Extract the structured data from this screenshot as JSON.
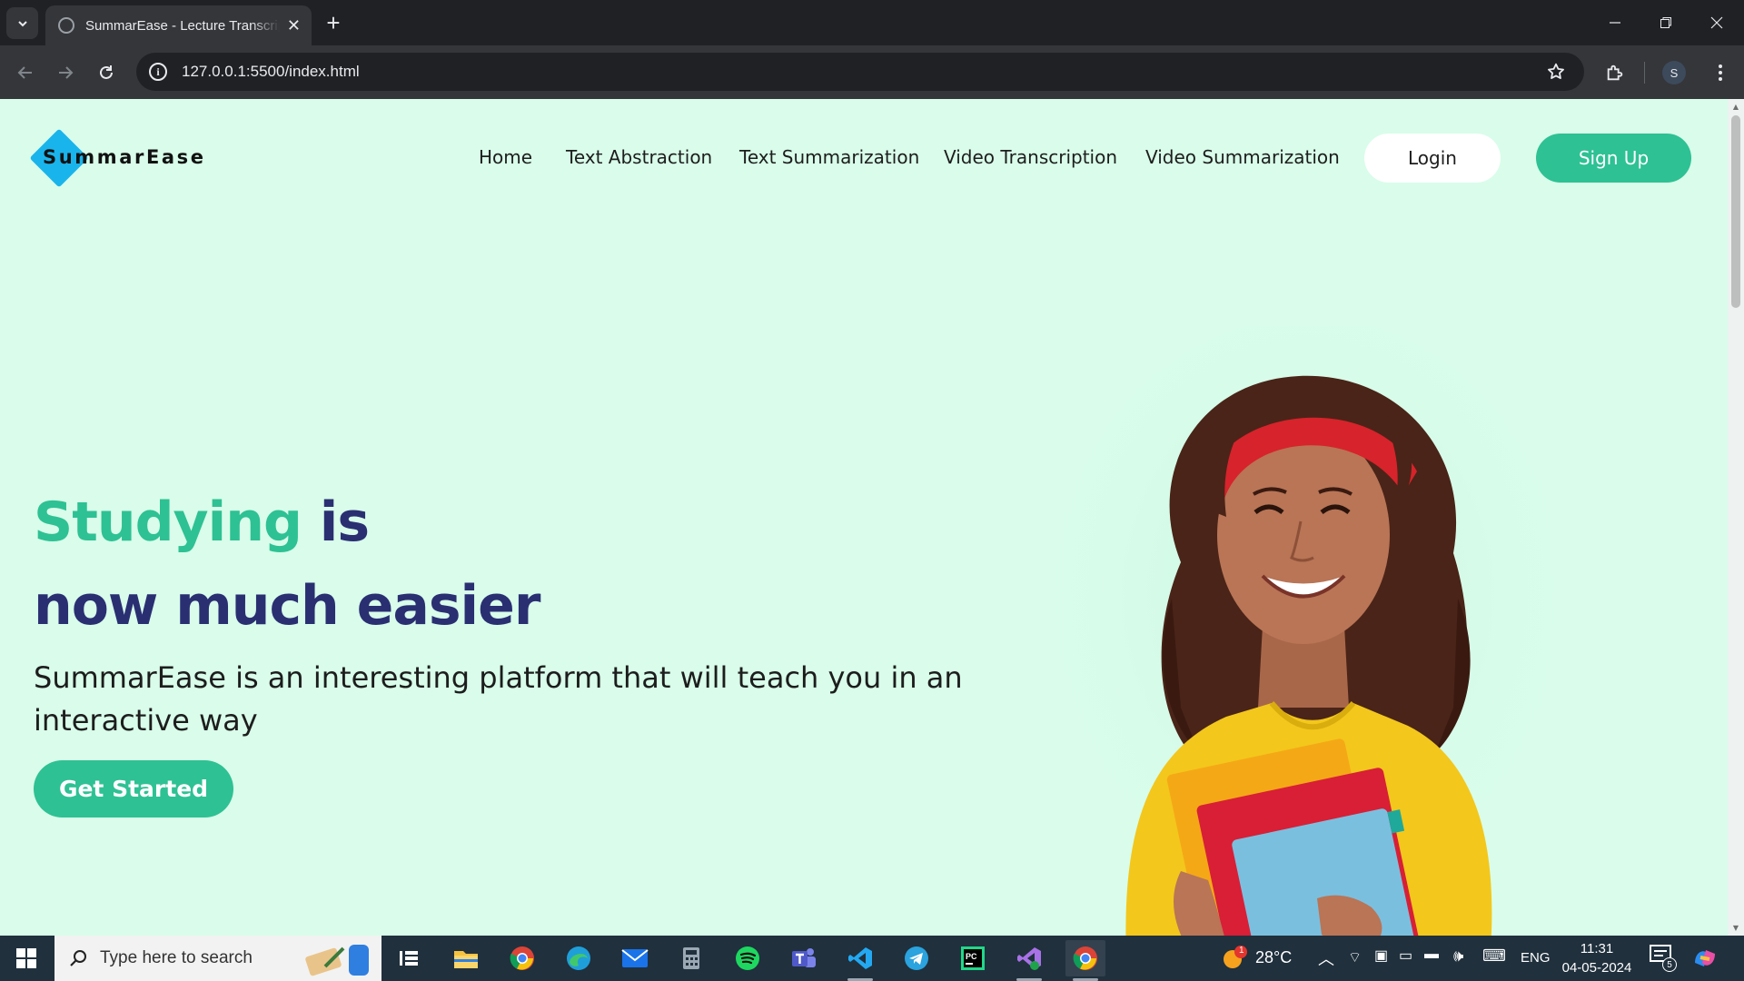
{
  "browser": {
    "tab_title": "SummarEase - Lecture Transcription",
    "url": "127.0.0.1:5500/index.html",
    "profile_initial": "S"
  },
  "site": {
    "logo_text": "SummarEase",
    "nav": [
      "Home",
      "Text Abstraction",
      "Text Summarization",
      "Video Transcription",
      "Video Summarization"
    ],
    "login_label": "Login",
    "signup_label": "Sign Up",
    "hero_accent": "Studying",
    "hero_title_rest": "is",
    "hero_title_line2": "now much easier",
    "hero_subtitle": "SummarEase is an interesting platform that will teach you in an interactive way",
    "cta_label": "Get Started",
    "colors": {
      "accent": "#2ec193",
      "heading": "#2a2f72",
      "background": "#d9fdea",
      "logo": "#1ab4ec"
    }
  },
  "taskbar": {
    "search_placeholder": "Type here to search",
    "weather_temp": "28°C",
    "language": "ENG",
    "time": "11:31",
    "date": "04-05-2024",
    "notification_count": "5",
    "weather_badge": "1"
  }
}
